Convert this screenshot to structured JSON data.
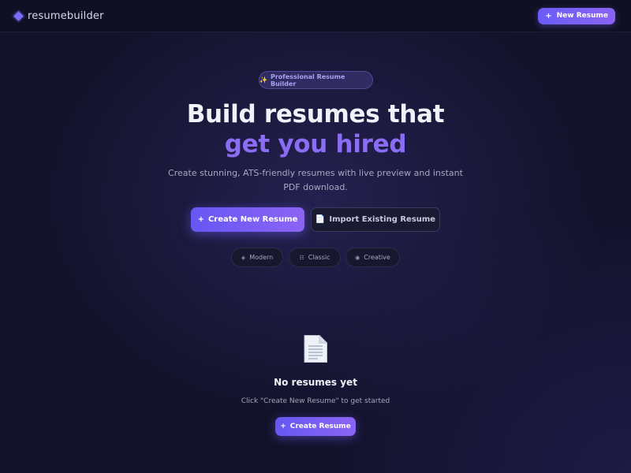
{
  "header": {
    "brand": "resumebuilder",
    "new_button": {
      "icon": "+",
      "label": "New Resume"
    }
  },
  "hero": {
    "badge": {
      "icon": "✨",
      "label": "Professional Resume Builder"
    },
    "title_line1": "Build resumes that",
    "title_line2": "get you hired",
    "subtitle": "Create stunning, ATS-friendly resumes with live preview and instant PDF download.",
    "primary_button": {
      "icon": "+",
      "label": "Create New Resume"
    },
    "secondary_button": {
      "icon": "📄",
      "label": "Import Existing Resume"
    },
    "templates": [
      {
        "icon": "◈",
        "icon_name": "diamond-icon",
        "label": "Modern"
      },
      {
        "icon": "☷",
        "icon_name": "grid-icon",
        "label": "Classic"
      },
      {
        "icon": "◉",
        "icon_name": "circle-dot-icon",
        "label": "Creative"
      }
    ]
  },
  "empty_state": {
    "icon": "document-icon",
    "title": "No resumes yet",
    "message": "Click \"Create New Resume\" to get started",
    "button": {
      "icon": "+",
      "label": "Create Resume"
    }
  },
  "colors": {
    "background": "#12122a",
    "accent": "#7c6cff",
    "accent_text": "#8a6cf5",
    "surface": "#17172e"
  }
}
